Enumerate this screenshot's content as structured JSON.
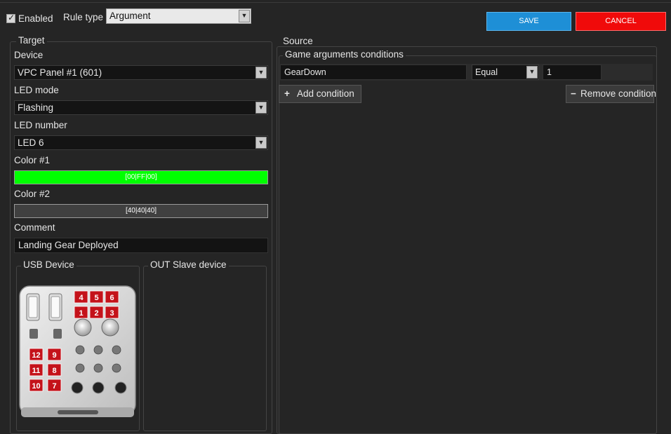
{
  "header": {
    "enabled_label": "Enabled",
    "enabled_checked": true,
    "rule_type_label": "Rule type",
    "rule_type_value": "Argument",
    "save_label": "SAVE",
    "cancel_label": "CANCEL"
  },
  "target": {
    "title": "Target",
    "device_label": "Device",
    "device_value": "VPC Panel #1 (601)",
    "led_mode_label": "LED mode",
    "led_mode_value": "Flashing",
    "led_number_label": "LED number",
    "led_number_value": "LED 6",
    "color1_label": "Color #1",
    "color1_value": "[00|FF|00]",
    "color1_hex": "#00ff00",
    "color2_label": "Color #2",
    "color2_value": "[40|40|40]",
    "color2_hex": "#404040",
    "comment_label": "Comment",
    "comment_value": "Landing Gear Deployed",
    "usb_device_title": "USB Device",
    "out_slave_title": "OUT Slave device",
    "device_buttons": [
      "4",
      "5",
      "6",
      "1",
      "2",
      "3",
      "12",
      "9",
      "11",
      "8",
      "10",
      "7"
    ]
  },
  "source": {
    "title": "Source",
    "conditions_title": "Game arguments conditions",
    "condition": {
      "argument": "GearDown",
      "operator": "Equal",
      "value": "1"
    },
    "add_condition_label": "Add condition",
    "remove_condition_label": "Remove condition"
  },
  "colors": {
    "save": "#1e8fd6",
    "cancel": "#f00a0a",
    "led_red": "#c4121a"
  }
}
